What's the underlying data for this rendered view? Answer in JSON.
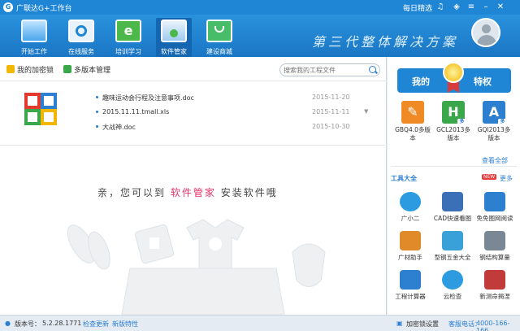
{
  "window": {
    "title": "广联达G+工作台",
    "daily_link": "每日精选"
  },
  "nav": [
    {
      "label": "开始工作",
      "icon": "monitor-icon"
    },
    {
      "label": "在线服务",
      "icon": "online-service-icon"
    },
    {
      "label": "培训学习",
      "icon": "training-icon"
    },
    {
      "label": "软件管家",
      "icon": "software-manager-icon"
    },
    {
      "label": "建设商城",
      "icon": "shopping-bag-icon"
    }
  ],
  "slogan": "第三代整体解决方案",
  "tabs": {
    "my_lock": "我的加密锁",
    "multi_version": "多版本管理"
  },
  "search": {
    "placeholder": "搜索我的工程文件"
  },
  "files": [
    {
      "name": "趣味运动会行程及注意事项.doc",
      "date": "2015-11-20",
      "more": ""
    },
    {
      "name": "2015.11.11.tmall.xls",
      "date": "2015-11-11",
      "more": "▼"
    },
    {
      "name": "大战神.doc",
      "date": "2015-10-30",
      "more": ""
    }
  ],
  "promo": {
    "prefix": "亲，您可以到",
    "highlight": "软件管家",
    "suffix": "安装软件哦"
  },
  "privileges": {
    "left": "我的",
    "right": "特权",
    "apps": [
      {
        "label": "GBQ4.0多版本",
        "icon": "gbq-icon",
        "color": "#f08a24",
        "glyph": "✎",
        "badge": ""
      },
      {
        "label": "GCL2013多版本",
        "icon": "gcl-icon",
        "color": "#3aa84a",
        "glyph": "H",
        "badge": "多"
      },
      {
        "label": "GQI2013多版本",
        "icon": "gqi-icon",
        "color": "#2d7fd0",
        "glyph": "A",
        "badge": "多"
      }
    ],
    "view_all": "查看全部"
  },
  "tools": {
    "title": "工具大全",
    "new_badge": "NEW",
    "more": "更多",
    "items": [
      {
        "label": "广小二",
        "icon": "mascot-icon",
        "color": "#2d9be0"
      },
      {
        "label": "CAD快速看图",
        "icon": "cad-viewer-icon",
        "color": "#3b6fb6"
      },
      {
        "label": "免免图网阅读",
        "icon": "pdf-reader-icon",
        "color": "#2d7fd0"
      },
      {
        "label": "广材助手",
        "icon": "material-helper-icon",
        "color": "#e08a2a"
      },
      {
        "label": "型钢五金大全",
        "icon": "steel-hardware-icon",
        "color": "#3aa0d8"
      },
      {
        "label": "钢结构算量",
        "icon": "steel-structure-icon",
        "color": "#7a8896"
      },
      {
        "label": "工程计算器",
        "icon": "calculator-icon",
        "color": "#2d7fd0"
      },
      {
        "label": "云检查",
        "icon": "cloud-check-icon",
        "color": "#2d9be0"
      },
      {
        "label": "新测命揭涅",
        "icon": "measurement-icon",
        "color": "#c23b3b"
      }
    ]
  },
  "status": {
    "version_label": "版本号：",
    "version": "5.2.28.1771",
    "check_update": "检查更新",
    "new_features": "新版特性",
    "lock_settings": "加密锁设置",
    "hotline_label": "客服电话：",
    "hotline": "4000-166-166"
  },
  "colors": {
    "primary": "#1f86d6",
    "accent_pink": "#e8336b",
    "link": "#2d7fd0"
  }
}
